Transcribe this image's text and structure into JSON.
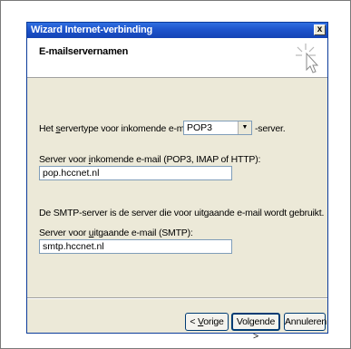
{
  "window": {
    "title": "Wizard Internet-verbinding",
    "close_glyph": "x"
  },
  "header": {
    "title": "E-mailservernamen",
    "icon": "wizard-cursor-icon"
  },
  "incoming_type": {
    "label_pre": "Het ",
    "label_accel": "s",
    "label_post": "ervertype voor inkomende e-mail is een:",
    "value": "POP3",
    "suffix": "-server."
  },
  "incoming_server": {
    "label_pre": "Server voor ",
    "label_accel": "i",
    "label_post": "nkomende e-mail (POP3, IMAP of HTTP):",
    "value": "pop.hccnet.nl"
  },
  "outgoing_server": {
    "info": "De SMTP-server is de server die voor uitgaande e-mail wordt gebruikt.",
    "label_pre": "Server voor ",
    "label_accel": "u",
    "label_post": "itgaande e-mail (SMTP):",
    "value": "smtp.hccnet.nl"
  },
  "buttons": {
    "back_pre": "< ",
    "back_accel": "V",
    "back_post": "orige",
    "next": "Volgende >",
    "cancel": "Annuleren"
  }
}
